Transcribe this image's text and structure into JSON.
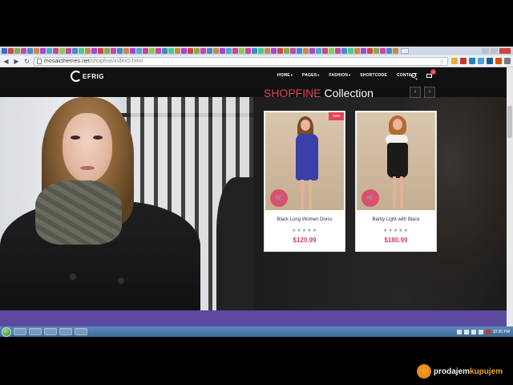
{
  "browser": {
    "url_host": "mosaicthemes.net",
    "url_path": "/shopfine/index5.html",
    "tab_colors": [
      "#3b6fc4",
      "#c44",
      "#8a4",
      "#c4a",
      "#48c",
      "#c84",
      "#a4c",
      "#4ac",
      "#c48",
      "#8c4",
      "#c4a",
      "#48c",
      "#4c8",
      "#c84",
      "#a4c",
      "#c44",
      "#8a4",
      "#c4a",
      "#48c",
      "#c84",
      "#a4c",
      "#4ac",
      "#c48",
      "#8c4",
      "#c4a",
      "#48c",
      "#4c8",
      "#c84",
      "#a4c",
      "#c44",
      "#8a4",
      "#c4a",
      "#48c",
      "#c84",
      "#a4c",
      "#4ac",
      "#c48",
      "#8c4",
      "#c4a",
      "#48c",
      "#4c8",
      "#c84",
      "#a4c",
      "#c44",
      "#8a4",
      "#c4a",
      "#48c",
      "#c84",
      "#a4c",
      "#4ac",
      "#c48",
      "#8c4",
      "#c4a",
      "#48c",
      "#4c8",
      "#c84",
      "#a4c",
      "#c44",
      "#8a4",
      "#c4a",
      "#48c",
      "#c84"
    ]
  },
  "site": {
    "logo_text": "EFRIG",
    "menu": [
      {
        "label": "HOME",
        "dropdown": true
      },
      {
        "label": "PAGES",
        "dropdown": true
      },
      {
        "label": "FASHION",
        "dropdown": true
      },
      {
        "label": "SHORTCODE",
        "dropdown": false
      },
      {
        "label": "CONTACT",
        "dropdown": false
      }
    ],
    "cart_count": "0",
    "collection_title_accent": "SHOPFINE",
    "collection_title_rest": " Collection",
    "slider_prev_icon": "chevron-left-icon",
    "slider_next_icon": "chevron-right-icon",
    "products": [
      {
        "name": "Black Long Women Dress",
        "price": "$120.99",
        "rating": "★★★★★",
        "badge": "new",
        "dress_color": "#3b3fa8"
      },
      {
        "name": "Barby Light with Black",
        "price": "$180.99",
        "rating": "★★★★★",
        "badge": "",
        "dress_color": "#1b1b1b"
      }
    ],
    "accent_color": "#e4415f",
    "band_color": "#5b4aa0"
  },
  "taskbar": {
    "clock": "10:30 PM"
  },
  "watermark": {
    "prefix": "prodajem",
    "highlight": "kupujem"
  }
}
